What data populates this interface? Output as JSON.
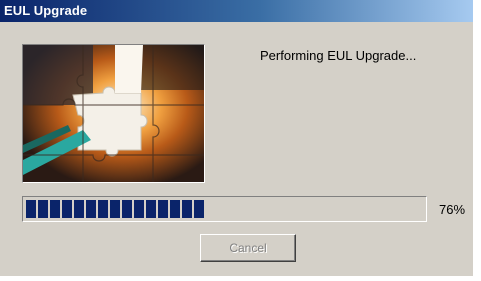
{
  "window": {
    "title": "EUL Upgrade"
  },
  "main": {
    "status_text": "Performing EUL Upgrade...",
    "picture_icon": "jigsaw-puzzle-image"
  },
  "progress": {
    "value": 0.76,
    "label": "76%",
    "total_blocks": 20
  },
  "buttons": {
    "cancel_label": "Cancel",
    "cancel_enabled": false
  },
  "colors": {
    "titlebar_start": "#0a246a",
    "titlebar_end": "#a6caf0",
    "progress_fill": "#0a246a",
    "window_bg": "#d4d0c8"
  }
}
